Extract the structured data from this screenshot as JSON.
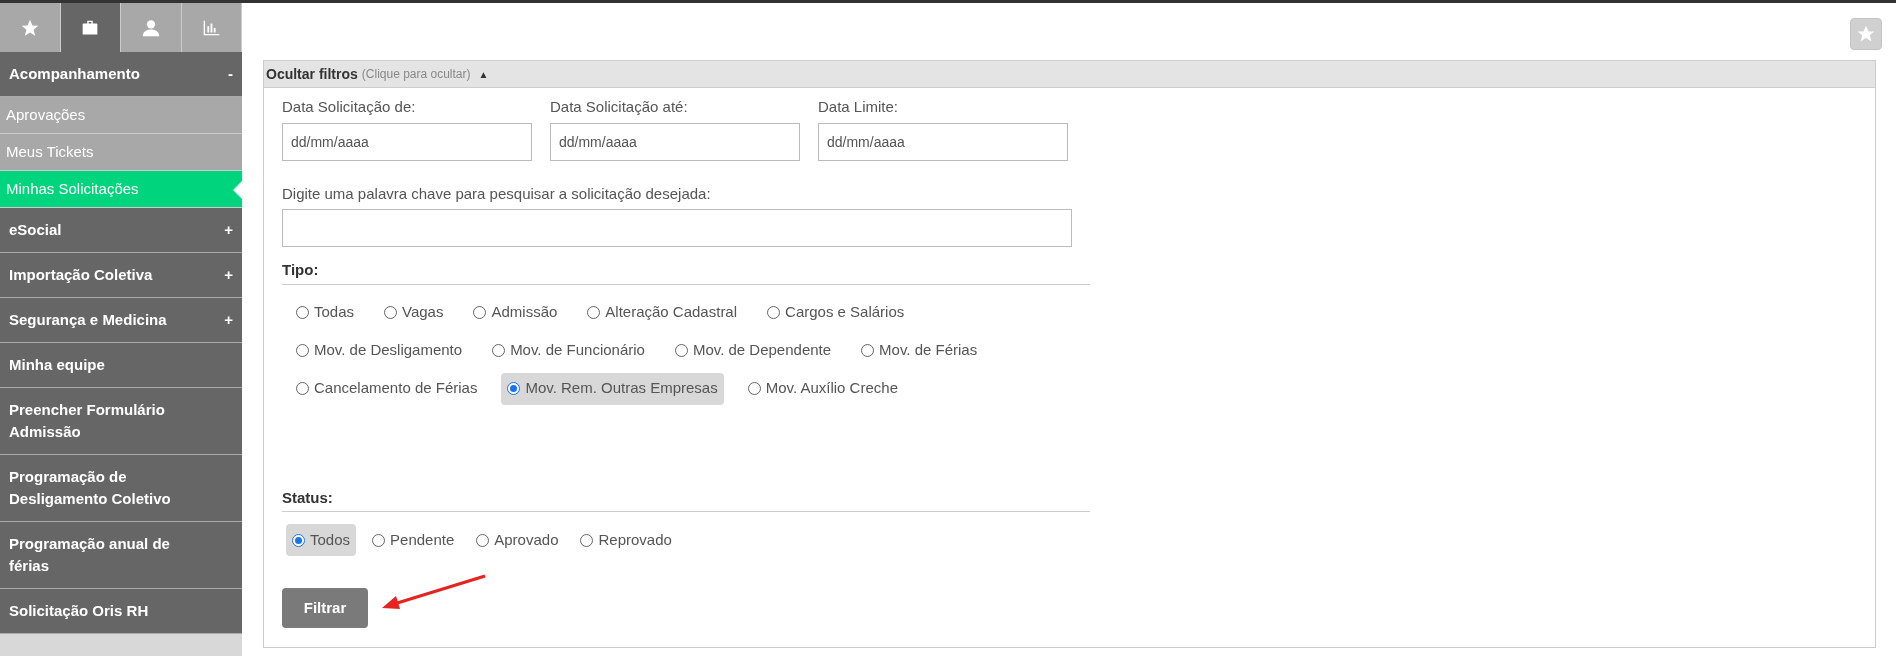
{
  "sidebar": {
    "tabs": [
      {
        "selected": false
      },
      {
        "selected": true
      },
      {
        "selected": false
      },
      {
        "selected": false
      }
    ],
    "items": [
      {
        "kind": "header",
        "label": "Acompanhamento",
        "toggle": "-"
      },
      {
        "kind": "subitem",
        "label": "Aprovações",
        "selected": false
      },
      {
        "kind": "subitem",
        "label": "Meus Tickets",
        "selected": false
      },
      {
        "kind": "subitem",
        "label": "Minhas Solicitações",
        "selected": true
      },
      {
        "kind": "header",
        "label": "eSocial",
        "toggle": "+"
      },
      {
        "kind": "header",
        "label": "Importação Coletiva",
        "toggle": "+"
      },
      {
        "kind": "header",
        "label": "Segurança e Medicina",
        "toggle": "+"
      },
      {
        "kind": "header",
        "label": "Minha equipe"
      },
      {
        "kind": "header",
        "label": "Preencher Formulário Admissão"
      },
      {
        "kind": "header",
        "label": "Programação de Desligamento Coletivo"
      },
      {
        "kind": "header",
        "label": "Programação anual de férias"
      },
      {
        "kind": "header",
        "label": "Solicitação Oris RH"
      }
    ]
  },
  "filters": {
    "title": "Ocultar filtros",
    "hint": "(Clique para ocultar)",
    "toggle": "▲",
    "date_fields": [
      {
        "label": "Data Solicitação de:",
        "placeholder": "dd/mm/aaaa"
      },
      {
        "label": "Data Solicitação até:",
        "placeholder": "dd/mm/aaaa"
      },
      {
        "label": "Data Limite:",
        "placeholder": "dd/mm/aaaa"
      }
    ],
    "keyword": {
      "label": "Digite uma palavra chave para pesquisar a solicitação desejada:"
    },
    "tipo": {
      "label": "Tipo:",
      "options": [
        {
          "label": "Todas",
          "selected": false
        },
        {
          "label": "Vagas",
          "selected": false
        },
        {
          "label": "Admissão",
          "selected": false
        },
        {
          "label": "Alteração Cadastral",
          "selected": false
        },
        {
          "label": "Cargos e Salários",
          "selected": false
        },
        {
          "label": "Mov. de Desligamento",
          "selected": false
        },
        {
          "label": "Mov. de Funcionário",
          "selected": false
        },
        {
          "label": "Mov. de Dependente",
          "selected": false
        },
        {
          "label": "Mov. de Férias",
          "selected": false
        },
        {
          "label": "Cancelamento de Férias",
          "selected": false
        },
        {
          "label": "Mov. Rem. Outras Empresas",
          "selected": true
        },
        {
          "label": "Mov. Auxílio Creche",
          "selected": false
        }
      ]
    },
    "status": {
      "label": "Status:",
      "options": [
        {
          "label": "Todos",
          "selected": true
        },
        {
          "label": "Pendente",
          "selected": false
        },
        {
          "label": "Aprovado",
          "selected": false
        },
        {
          "label": "Reprovado",
          "selected": false
        }
      ]
    },
    "submit": "Filtrar"
  }
}
